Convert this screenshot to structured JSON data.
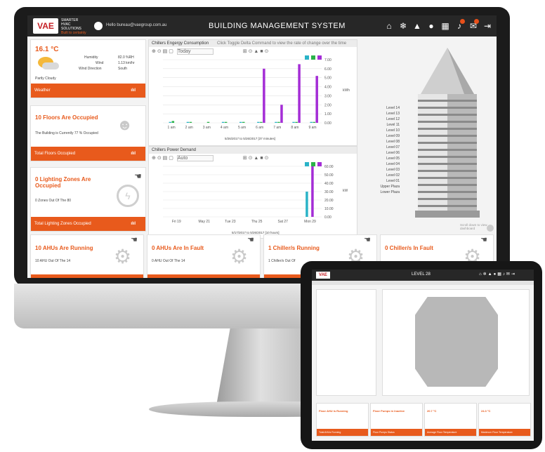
{
  "header": {
    "logo_text": "VAE",
    "logo_lines": [
      "SMARTER",
      "HVAC",
      "SOLUTIONS",
      "GROUP"
    ],
    "logo_tagline": "Built to certainty",
    "user_email": "Hello bureau@vaegroup.com.au",
    "title": "BUILDING MANAGEMENT SYSTEM",
    "icons": [
      "home-icon",
      "snowflake-icon",
      "building-icon",
      "info-icon",
      "calendar-icon",
      "bell-icon",
      "mail-icon",
      "logout-icon"
    ]
  },
  "weather": {
    "temp": "16.1 °C",
    "condition": "Partly Cloudy",
    "humidity_label": "Humidity",
    "humidity": "82.0 %RH",
    "wind_label": "Wind",
    "wind": "1.13 km/hr",
    "wind_dir_label": "Wind Direction",
    "wind_dir": "South",
    "bar_label": "Weather"
  },
  "floors": {
    "title": "10 Floors Are Occupied",
    "subtitle": "The Building is Currently 77 % Occupied",
    "bar_label": "Total Floors Occupied"
  },
  "lighting": {
    "title": "0 Lighting Zones Are Occupied",
    "subtitle": "0 Zones Out Of The 80",
    "bar_label": "Total Lighting Zones Occupied"
  },
  "bottom_cards": [
    {
      "title": "10 AHUs Are Running",
      "subtitle": "10 AHU Out Of The 14"
    },
    {
      "title": "0 AHUs Are In Fault",
      "subtitle": "0 AHU Out Of The 14"
    },
    {
      "title": "1 Chiller/s Running",
      "subtitle": "1 Chiller/s Out Of"
    },
    {
      "title": "0 Chiller/s In Fault",
      "subtitle": ""
    }
  ],
  "chart1": {
    "panel_title": "Chillers Engergy Consumption",
    "hint": "Click Toggle Delta Command to view the rate of change over the time",
    "range": "Today",
    "caption": "5/26/2017 to 5/26/2017   [37 minutes]",
    "unit": "kWh",
    "chart_data": {
      "type": "bar",
      "categories": [
        "1 am",
        "2 am",
        "3 am",
        "4 am",
        "5 am",
        "6 am",
        "7 am",
        "8 am",
        "9 am"
      ],
      "y_ticks": [
        "7.00",
        "6.00",
        "5.00",
        "4.00",
        "3.00",
        "2.00",
        "1.00",
        "0.00"
      ],
      "ylim": [
        0,
        7
      ],
      "series": [
        {
          "color": "#2ab3c7",
          "values": [
            0.1,
            0.1,
            0,
            0.1,
            0.1,
            0.1,
            0.1,
            0.1,
            0.1
          ]
        },
        {
          "color": "#2bb34a",
          "values": [
            0.2,
            0.1,
            0.1,
            0.1,
            0.1,
            0.1,
            0.1,
            0.1,
            0.1
          ]
        },
        {
          "color": "#a42dd6",
          "values": [
            0,
            0,
            0,
            0,
            0,
            6.0,
            2.0,
            6.5,
            5.2
          ]
        }
      ]
    }
  },
  "chart2": {
    "panel_title": "Chillers Power Demand",
    "range": "Auto",
    "caption": "5/17/2017 to 5/26/2017   [10 hours]",
    "unit": "kW",
    "chart_data": {
      "type": "bar",
      "categories": [
        "Fri 19",
        "May 21",
        "Tue 23",
        "Thu 25",
        "Sat 27",
        "Mon 29"
      ],
      "y_ticks": [
        "60.00",
        "50.00",
        "40.00",
        "30.00",
        "20.00",
        "10.00",
        "0.00"
      ],
      "ylim": [
        0,
        60
      ],
      "series": [
        {
          "color": "#2ab3c7",
          "values": [
            0,
            0,
            0,
            0,
            0,
            30
          ]
        },
        {
          "color": "#2bb34a",
          "values": [
            0,
            0,
            0,
            0,
            0,
            0
          ]
        },
        {
          "color": "#a42dd6",
          "values": [
            0,
            0,
            0,
            0,
            0,
            60
          ]
        }
      ]
    }
  },
  "levels": [
    "Level 14",
    "Level 13",
    "Level 12",
    "Level 11",
    "Level 10",
    "Level 09",
    "Level 08",
    "Level 07",
    "Level 06",
    "Level 05",
    "Level 04",
    "Level 03",
    "Level 02",
    "Level 01",
    "Upper Plaza",
    "Lower Plaza"
  ],
  "scroll_hint": "Scroll down to view dashboard",
  "tablet": {
    "title": "LEVEL 28",
    "bottom_cards": [
      {
        "title": "Floor AHU is Running",
        "bar": "Total AHUs Running"
      },
      {
        "title": "Floor Pumps in Inactive",
        "bar": "Floor Pumps Status"
      },
      {
        "title": "20.7 °C",
        "bar": "Average Floor Temperature"
      },
      {
        "title": "24.3 °C",
        "bar": "Maximum Floor Temperature"
      }
    ]
  }
}
